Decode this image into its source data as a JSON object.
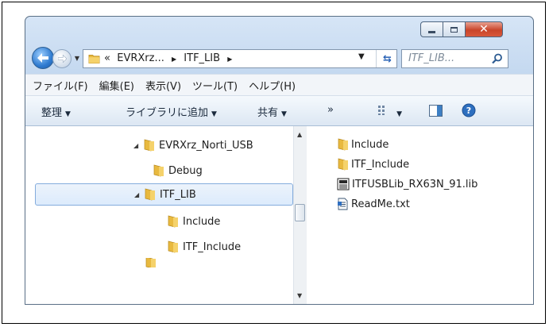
{
  "window": {
    "controls": {
      "minimize": "minimize",
      "maximize": "maximize",
      "close": "✕"
    }
  },
  "address": {
    "overflow": "«",
    "segments": [
      "EVRXrz...",
      "ITF_LIB"
    ]
  },
  "search": {
    "placeholder": "ITF_LIB..."
  },
  "menu": [
    "ファイル(F)",
    "編集(E)",
    "表示(V)",
    "ツール(T)",
    "ヘルプ(H)"
  ],
  "toolbar": {
    "organize": "整理",
    "add_to_library": "ライブラリに追加",
    "share": "共有",
    "more": "»"
  },
  "tree": [
    {
      "label": "EVRXrz_Norti_USB",
      "expanded": true
    },
    {
      "label": "Debug"
    },
    {
      "label": "ITF_LIB",
      "expanded": true,
      "selected": true
    },
    {
      "label": "Include"
    },
    {
      "label": "ITF_Include"
    }
  ],
  "files": [
    {
      "name": "Include",
      "icon": "folder-icon"
    },
    {
      "name": "ITF_Include",
      "icon": "folder-icon"
    },
    {
      "name": "ITFUSBLib_RX63N_91.lib",
      "icon": "library-file-icon"
    },
    {
      "name": "ReadMe.txt",
      "icon": "text-file-icon"
    }
  ],
  "colors": {
    "folder": "#e8b93f",
    "selection": "#dcebfc",
    "chrome": "#c2d7ef"
  }
}
